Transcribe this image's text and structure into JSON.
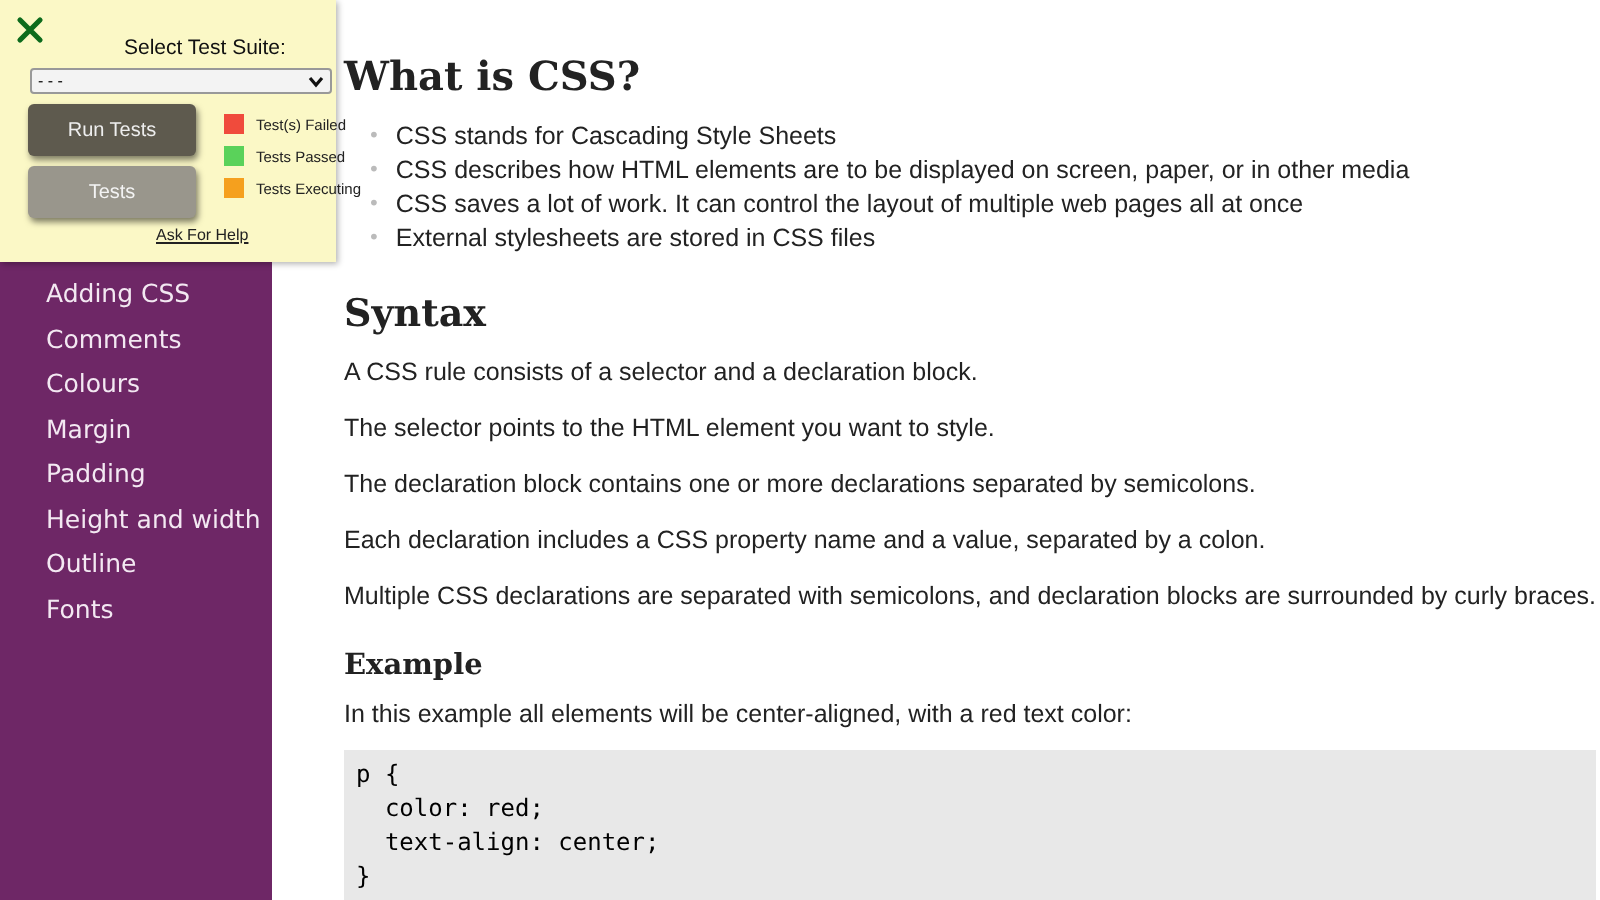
{
  "test_panel": {
    "title": "Select Test Suite:",
    "suite_select": {
      "value": "- - -"
    },
    "buttons": [
      {
        "label": "Run Tests",
        "kind": "primary"
      },
      {
        "label": "Tests",
        "kind": "secondary"
      }
    ],
    "legend": [
      {
        "label": "Test(s) Failed",
        "color": "#f04b3c"
      },
      {
        "label": "Tests Passed",
        "color": "#5ad25a"
      },
      {
        "label": "Tests Executing",
        "color": "#f5a01e"
      }
    ],
    "help_link": "Ask For Help"
  },
  "sidebar": {
    "items": [
      {
        "label": "Adding CSS"
      },
      {
        "label": "Comments"
      },
      {
        "label": "Colours"
      },
      {
        "label": "Margin"
      },
      {
        "label": "Padding"
      },
      {
        "label": "Height and width"
      },
      {
        "label": "Outline"
      },
      {
        "label": "Fonts"
      }
    ]
  },
  "content": [
    {
      "kind": "h1",
      "text": "What is CSS?"
    },
    {
      "kind": "list",
      "marker": "•",
      "items": [
        "CSS stands for Cascading Style Sheets",
        "CSS describes how HTML elements are to be displayed on screen, paper, or in other media",
        "CSS saves a lot of work. It can control the layout of multiple web pages all at once",
        "External stylesheets are stored in CSS files"
      ]
    },
    {
      "kind": "h2",
      "text": "Syntax"
    },
    {
      "kind": "p",
      "text": "A CSS rule consists of a selector and a declaration block."
    },
    {
      "kind": "p",
      "text": "The selector points to the HTML element you want to style."
    },
    {
      "kind": "p",
      "text": "The declaration block contains one or more declarations separated by semicolons."
    },
    {
      "kind": "p",
      "text": "Each declaration includes a CSS property name and a value, separated by a colon."
    },
    {
      "kind": "p",
      "text": "Multiple CSS declarations are separated with semicolons, and declaration blocks are surrounded by curly braces."
    },
    {
      "kind": "h3",
      "text": "Example"
    },
    {
      "kind": "p",
      "text": "In this example all elements will be center-aligned, with a red text color:"
    },
    {
      "kind": "code",
      "lines": [
        "p {",
        "  color: red;",
        "  text-align: center;",
        "}"
      ]
    }
  ]
}
